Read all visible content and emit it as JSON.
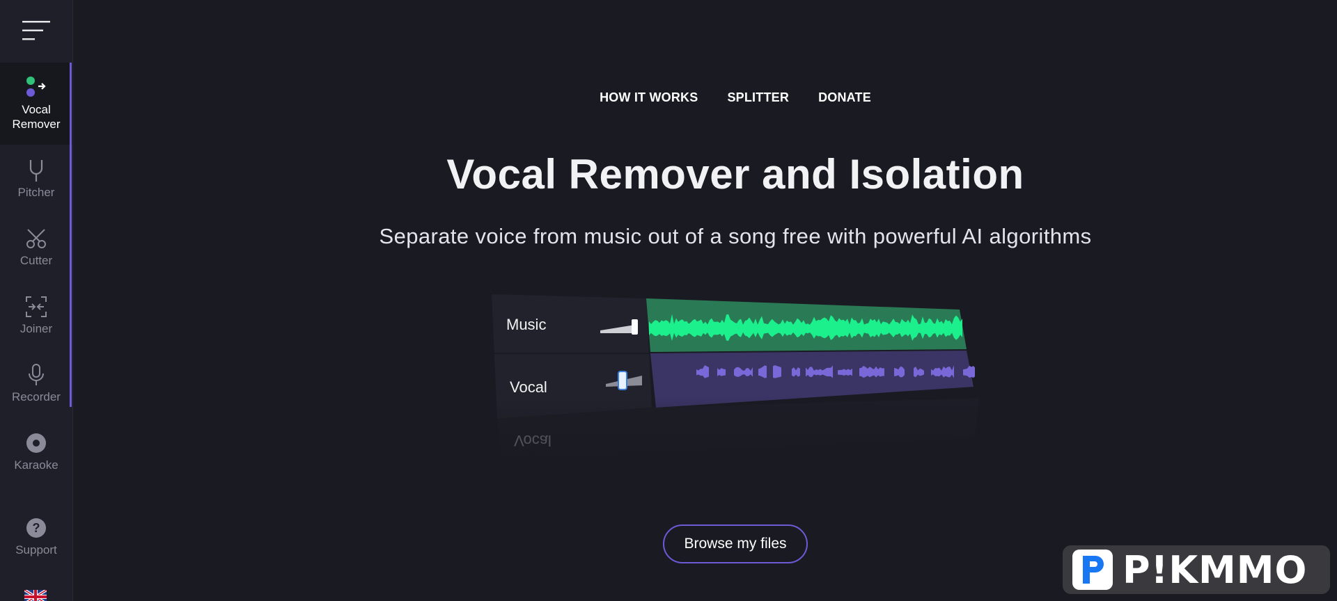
{
  "sidebar": {
    "menu_icon": "hamburger-menu-icon",
    "items": [
      {
        "label_line1": "Vocal",
        "label_line2": "Remover",
        "icon": "vocal-remover-icon",
        "active": true
      },
      {
        "label": "Pitcher",
        "icon": "tuning-fork-icon"
      },
      {
        "label": "Cutter",
        "icon": "scissors-icon"
      },
      {
        "label": "Joiner",
        "icon": "joiner-icon"
      },
      {
        "label": "Recorder",
        "icon": "microphone-icon"
      },
      {
        "label": "Karaoke",
        "icon": "disc-icon"
      },
      {
        "label": "Support",
        "icon": "question-icon"
      }
    ],
    "language_icon": "uk-flag-icon"
  },
  "nav": {
    "how_it_works": "HOW IT WORKS",
    "splitter": "SPLITTER",
    "donate": "DONATE"
  },
  "hero": {
    "title": "Vocal Remover and Isolation",
    "subtitle": "Separate voice from music out of a song free with powerful AI algorithms"
  },
  "mixer": {
    "track_music": "Music",
    "track_vocal": "Vocal",
    "track_reflection": "Vocal"
  },
  "actions": {
    "browse": "Browse my files"
  },
  "watermark": {
    "text": "P!KMMO"
  },
  "colors": {
    "background": "#1a1a22",
    "sidebar": "#1f1f29",
    "accent": "#6b5bd6",
    "music_wave": "#1bf08c",
    "vocal_wave": "#7a68d8"
  }
}
